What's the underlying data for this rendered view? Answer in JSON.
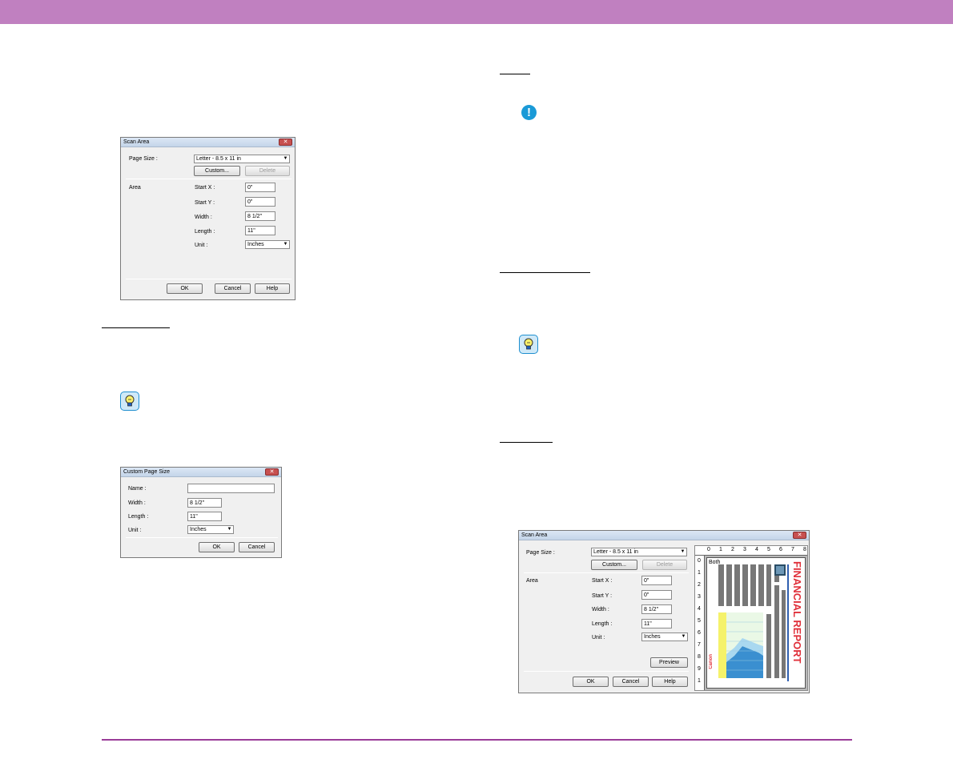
{
  "scan_area_small": {
    "title": "Scan Area",
    "close_glyph": "✕",
    "page_size_label": "Page Size :",
    "page_size_value": "Letter - 8.5 x 11 in",
    "custom_button": "Custom...",
    "delete_button": "Delete",
    "area_label": "Area",
    "start_x_label": "Start X :",
    "start_x_value": "0\"",
    "start_y_label": "Start Y :",
    "start_y_value": "0\"",
    "width_label": "Width :",
    "width_value": "8 1/2\"",
    "length_label": "Length :",
    "length_value": "11\"",
    "unit_label": "Unit :",
    "unit_value": "Inches",
    "ok_button": "OK",
    "cancel_button": "Cancel",
    "help_button": "Help"
  },
  "custom_page_size": {
    "title": "Custom Page Size",
    "close_glyph": "✕",
    "name_label": "Name :",
    "name_value": "",
    "width_label": "Width :",
    "width_value": "8 1/2\"",
    "length_label": "Length :",
    "length_value": "11\"",
    "unit_label": "Unit :",
    "unit_value": "Inches",
    "ok_button": "OK",
    "cancel_button": "Cancel"
  },
  "scan_area_large": {
    "title": "Scan Area",
    "close_glyph": "✕",
    "page_size_label": "Page Size :",
    "page_size_value": "Letter - 8.5 x 11 in",
    "custom_button": "Custom...",
    "delete_button": "Delete",
    "area_label": "Area",
    "start_x_label": "Start X :",
    "start_x_value": "0\"",
    "start_y_label": "Start Y :",
    "start_y_value": "0\"",
    "width_label": "Width :",
    "width_value": "8 1/2\"",
    "length_label": "Length :",
    "length_value": "11\"",
    "unit_label": "Unit :",
    "unit_value": "Inches",
    "preview_button": "Preview",
    "ok_button": "OK",
    "cancel_button": "Cancel",
    "help_button": "Help",
    "preview": {
      "side_label": "Both",
      "ruler_top": [
        "0",
        "1",
        "2",
        "3",
        "4",
        "5",
        "6",
        "7",
        "8"
      ],
      "ruler_left": [
        "0",
        "1",
        "2",
        "3",
        "4",
        "5",
        "6",
        "7",
        "8",
        "9",
        "1"
      ],
      "report_title": "FINANCIAL REPORT",
      "brand": "Canon"
    }
  },
  "icons": {
    "warning": "!",
    "colors": {
      "header_bar": "#c080c0",
      "footer_rule": "#9a3c98",
      "icon_blue": "#1a9ad7",
      "report_red": "#e0303a",
      "report_blue": "#2f5fb0"
    }
  }
}
